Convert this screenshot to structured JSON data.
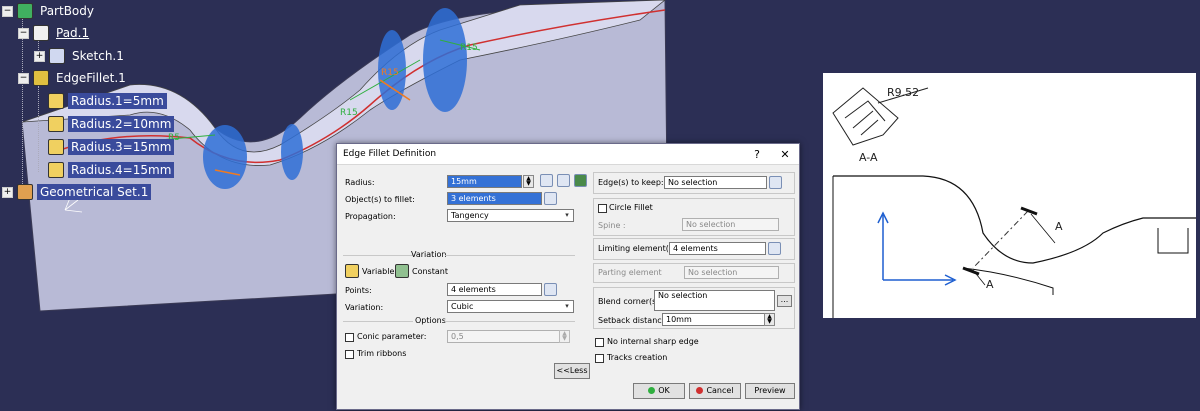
{
  "tree": {
    "items": [
      {
        "label": "PartBody",
        "icon": "partbody-gears-icon"
      },
      {
        "label": "Pad.1",
        "icon": "pad-icon"
      },
      {
        "label": "Sketch.1",
        "icon": "sketch-icon"
      },
      {
        "label": "EdgeFillet.1",
        "icon": "edge-fillet-icon"
      },
      {
        "label": "Radius.1=5mm",
        "icon": "parameter-icon"
      },
      {
        "label": "Radius.2=10mm",
        "icon": "parameter-icon"
      },
      {
        "label": "Radius.3=15mm",
        "icon": "parameter-icon"
      },
      {
        "label": "Radius.4=15mm",
        "icon": "parameter-icon"
      },
      {
        "label": "Geometrical Set.1",
        "icon": "geometrical-set-icon"
      }
    ]
  },
  "model": {
    "annotations": [
      "R5",
      "R15",
      "R15",
      "R15"
    ]
  },
  "dialog": {
    "title": "Edge Fillet Definition",
    "help": "?",
    "close": "✕",
    "radius_label": "Radius:",
    "radius_value": "15mm",
    "objects_label": "Object(s) to fillet:",
    "objects_value": "3 elements",
    "propagation_label": "Propagation:",
    "propagation_value": "Tangency",
    "variation_header": "Variation",
    "variable_label": "Variable",
    "constant_label": "Constant",
    "points_label": "Points:",
    "points_value": "4 elements",
    "variation_label": "Variation:",
    "variation_value": "Cubic",
    "options_header": "Options",
    "conic_label": "Conic parameter:",
    "conic_value": "0,5",
    "trim_label": "Trim ribbons",
    "less_button": "<<Less",
    "edges_keep_label": "Edge(s) to keep:",
    "edges_keep_value": "No selection",
    "circle_fillet_label": "Circle Fillet",
    "spine_label": "Spine :",
    "spine_value": "No selection",
    "limiting_label": "Limiting element(s):",
    "limiting_value": "4 elements",
    "parting_label": "Parting element",
    "parting_value": "No selection",
    "blend_label": "Blend corner(s)",
    "blend_value": "No selection",
    "setback_label": "Setback distance:",
    "setback_value": "10mm",
    "no_internal_label": "No internal sharp edge",
    "tracks_label": "Tracks creation",
    "ok_button": "OK",
    "cancel_button": "Cancel",
    "preview_button": "Preview"
  },
  "drawing": {
    "radius_label": "R9.52",
    "section_label": "A-A",
    "section_mark_1": "A",
    "section_mark_2": "A"
  },
  "colors": {
    "background": "#2c2f55",
    "part_face": "#c4c6e0",
    "fillet_ribbon": "#2f6fd6",
    "selection_blue": "#3471d6",
    "axis_blue": "#1e5fd0"
  }
}
